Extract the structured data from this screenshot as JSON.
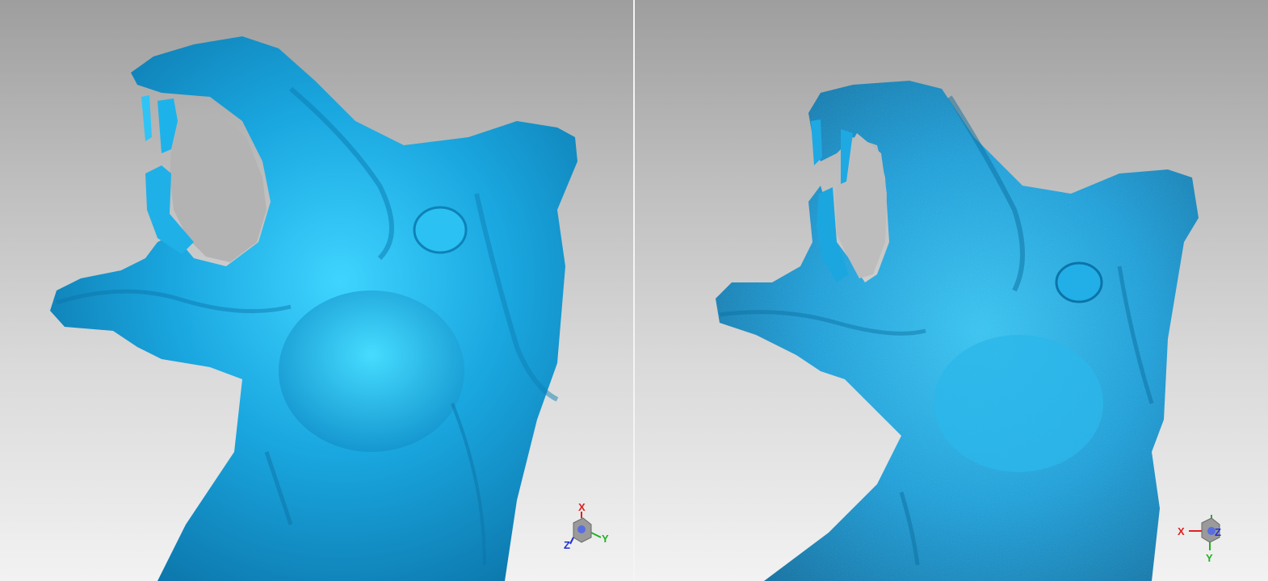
{
  "viewports": [
    {
      "id": "smooth",
      "mesh_color": "#1aa7e0",
      "triad": {
        "x_label": "X",
        "y_label": "Y",
        "z_label": "Z"
      }
    },
    {
      "id": "raw",
      "mesh_color": "#1aa0dc",
      "triad": {
        "x_label": "X",
        "y_label": "Y",
        "z_label": "Z"
      }
    }
  ],
  "colors": {
    "axis_x": "#e02020",
    "axis_y": "#22b022",
    "axis_z": "#2030d0"
  }
}
